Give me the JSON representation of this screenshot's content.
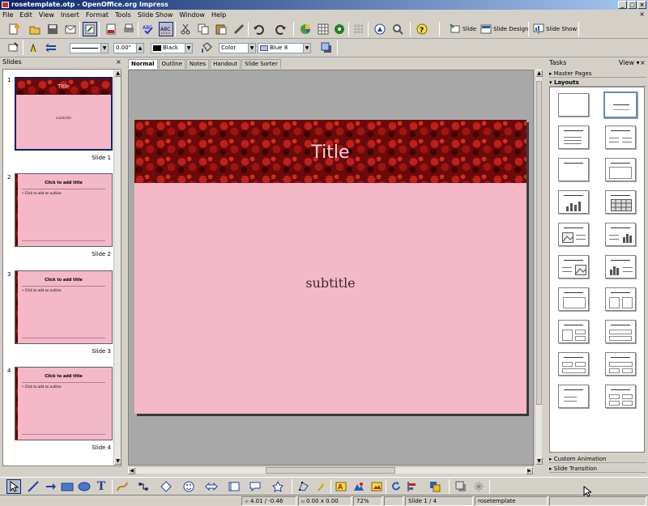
{
  "window": {
    "title": "rosetemplate.otp - OpenOffice.org Impress"
  },
  "menu": [
    "File",
    "Edit",
    "View",
    "Insert",
    "Format",
    "Tools",
    "Slide Show",
    "Window",
    "Help"
  ],
  "toolbar": {
    "slide_label": "Slide",
    "slide_design_label": "Slide Design",
    "slide_show_label": "Slide Show"
  },
  "line_toolbar": {
    "line_width": "0.00\"",
    "line_color": "Black",
    "area_style": "Color",
    "area_color": "Blue 8"
  },
  "slides_panel": {
    "title": "Slides",
    "slides": [
      {
        "number": "1",
        "label": "Slide 1",
        "thumb_title": "Title",
        "thumb_subtitle": "subtitle"
      },
      {
        "number": "2",
        "label": "Slide 2",
        "thumb_title": "Click to add title",
        "thumb_text": "• Click to add an outline"
      },
      {
        "number": "3",
        "label": "Slide 3",
        "thumb_title": "Click to add title",
        "thumb_text": "• Click to add an outline"
      },
      {
        "number": "4",
        "label": "Slide 4",
        "thumb_title": "Click to add title",
        "thumb_text": "• Click to add an outline"
      }
    ]
  },
  "view_tabs": [
    "Normal",
    "Outline",
    "Notes",
    "Handout",
    "Slide Sorter"
  ],
  "slide": {
    "title": "Title",
    "subtitle": "subtitle"
  },
  "tasks_panel": {
    "title": "Tasks",
    "view_label": "View",
    "master_pages": "Master Pages",
    "layouts": "Layouts",
    "custom_animation": "Custom Animation",
    "slide_transition": "Slide Transition"
  },
  "statusbar": {
    "position": "4.01 / -0.46",
    "size": "0.00 x 0.00",
    "zoom": "72%",
    "slide": "Slide 1 / 4",
    "template": "rosetemplate"
  },
  "colors": {
    "slide_bg": "#f4b8c8",
    "banner": "#8b1010",
    "title_text": "#f3d4d9"
  }
}
